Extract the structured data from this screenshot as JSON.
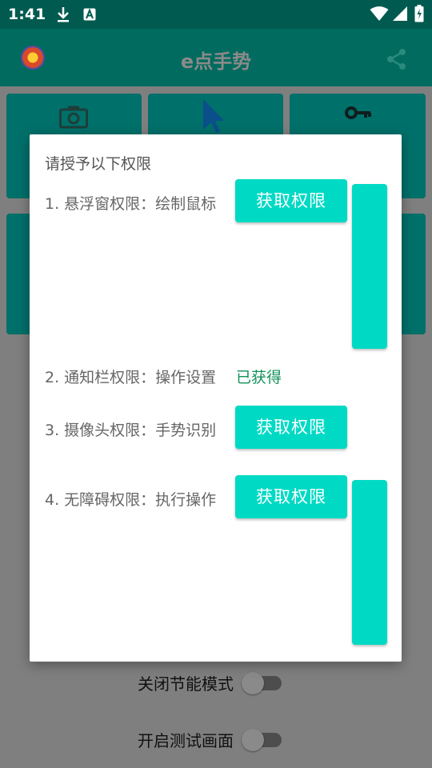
{
  "status": {
    "time": "1:41",
    "icons": [
      "download-icon",
      "a-badge-icon",
      "wifi-icon",
      "signal-icon",
      "battery-icon"
    ]
  },
  "app": {
    "title": "e点手势",
    "logo_icon": "app-logo",
    "share_icon": "share-icon"
  },
  "tiles": {
    "icons": [
      "camera-icon",
      "cursor-icon",
      "key-icon"
    ]
  },
  "bottom": {
    "power_save_label": "关闭节能模式",
    "power_save_on": false,
    "test_screen_label": "开启测试画面",
    "test_screen_on": false
  },
  "dialog": {
    "title": "请授予以下权限",
    "permissions": [
      {
        "label": "1. 悬浮窗权限：绘制鼠标",
        "button": "获取权限"
      },
      {
        "label": "2. 通知栏权限：操作设置",
        "status": "已获得"
      },
      {
        "label": "3. 摄像头权限：手势识别",
        "button": "获取权限"
      },
      {
        "label": "4. 无障碍权限：执行操作",
        "button": "获取权限"
      }
    ]
  },
  "colors": {
    "primary": "#006b5e",
    "accent": "#00dac4",
    "granted": "#12915a",
    "scrim": "#7f7f7f"
  }
}
